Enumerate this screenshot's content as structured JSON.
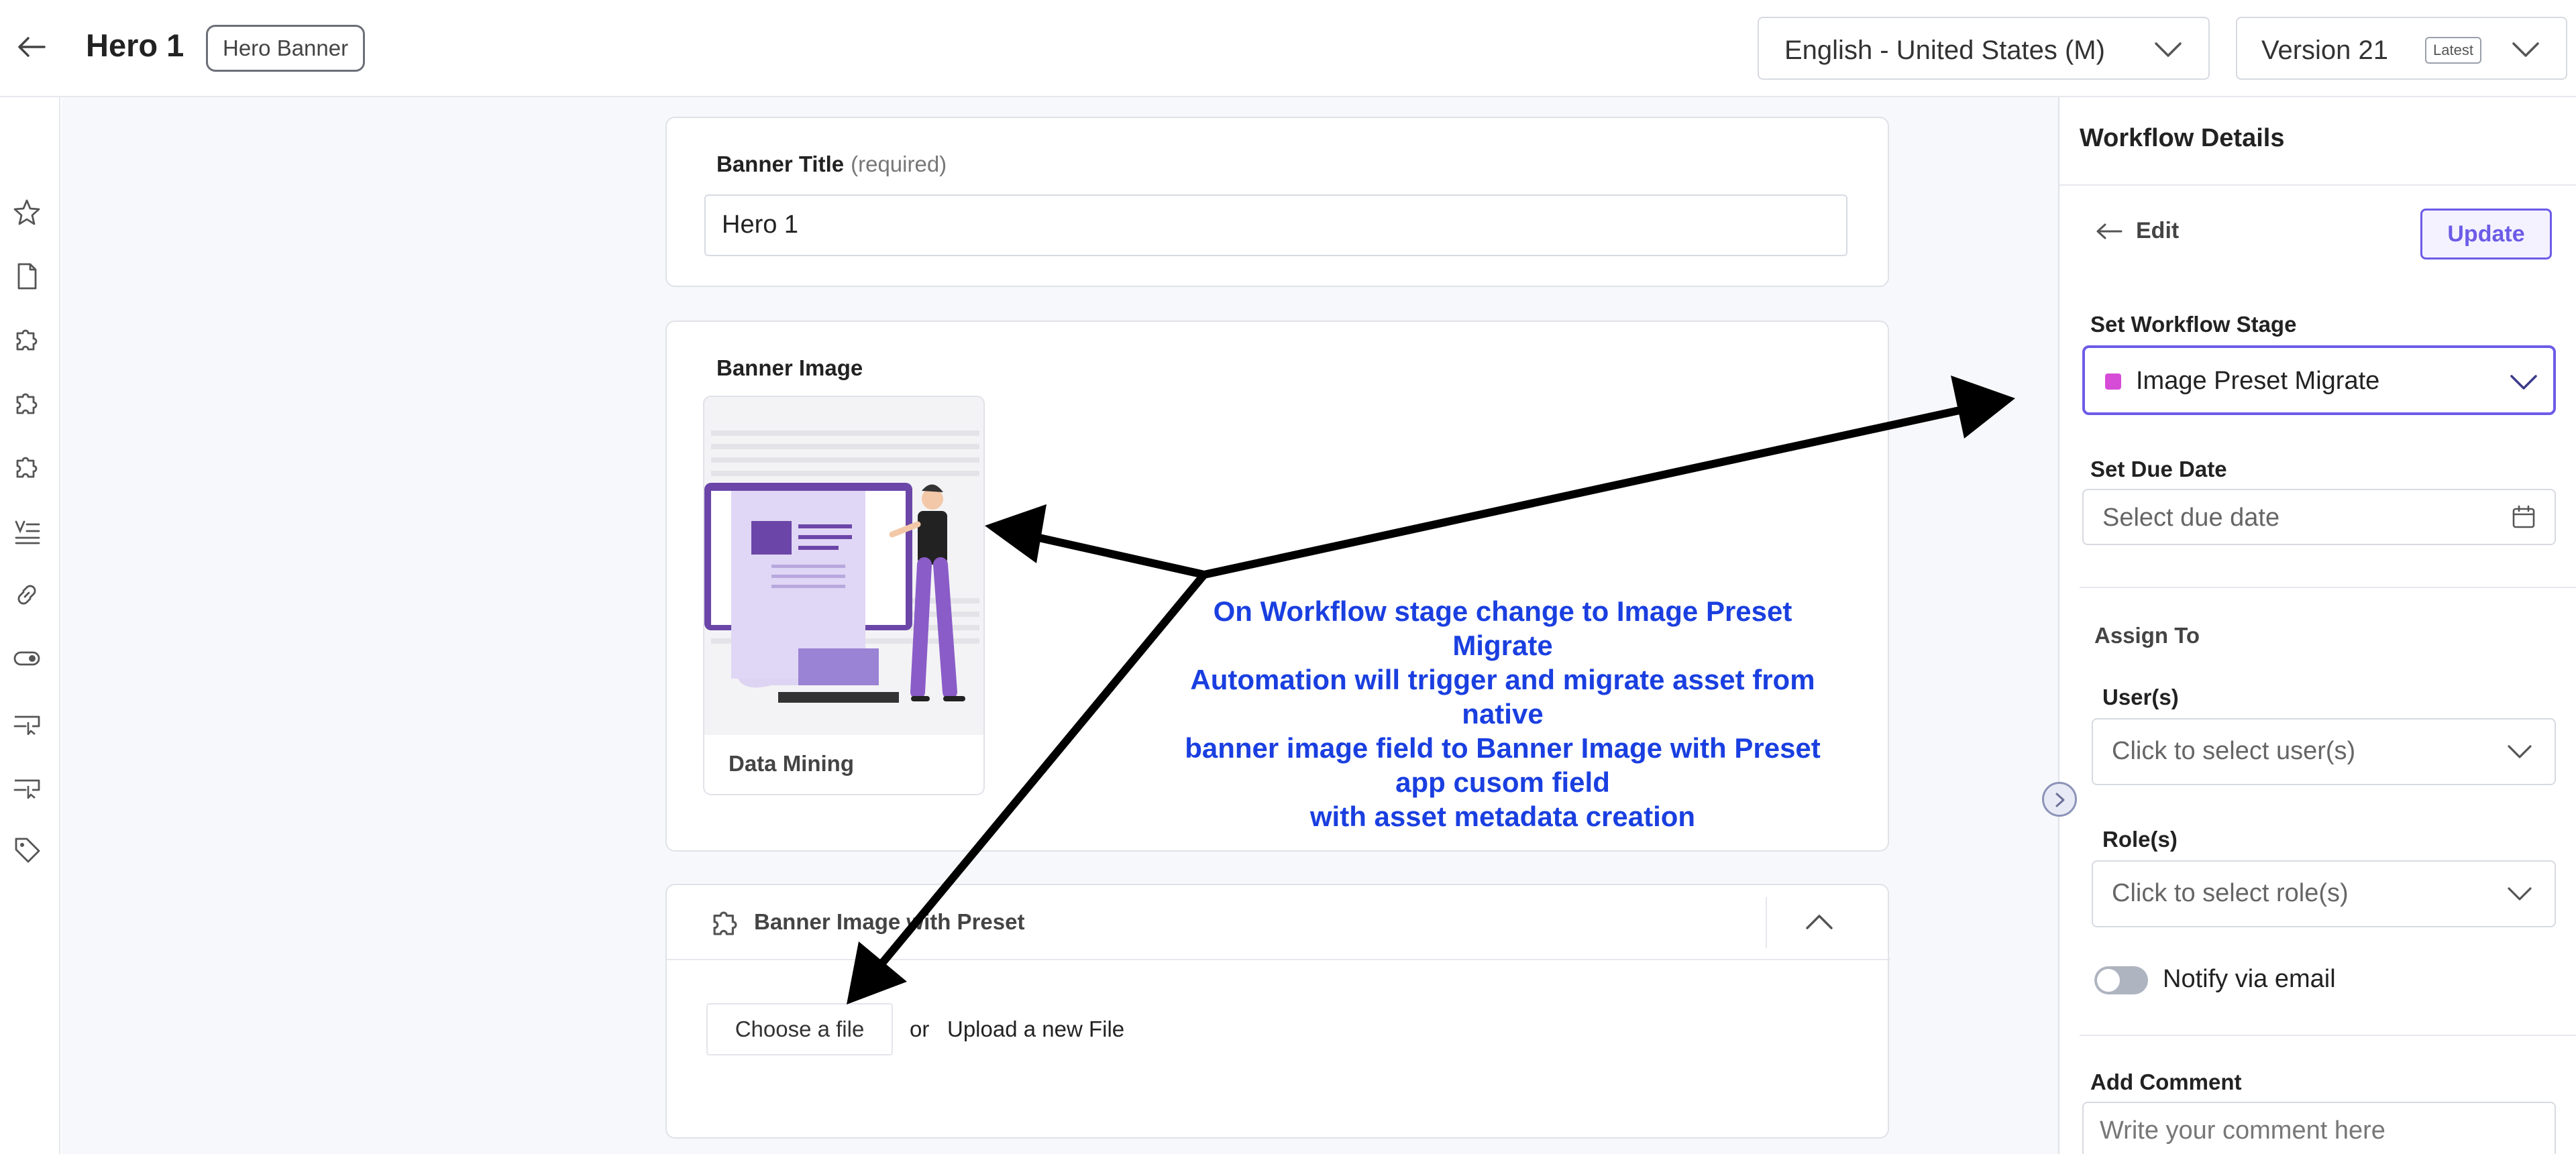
{
  "header": {
    "entry_title": "Hero 1",
    "content_type_badge": "Hero Banner",
    "locale": "English - United States (M)",
    "version": "Version 21",
    "version_badge": "Latest"
  },
  "sidebar": {
    "icons": [
      "star-icon",
      "document-icon",
      "puzzle-icon",
      "puzzle-icon",
      "puzzle-icon",
      "list-icon",
      "link-icon",
      "toggle-icon",
      "cursor-box-icon",
      "cursor-box-icon",
      "tag-icon"
    ]
  },
  "main": {
    "banner_title": {
      "label": "Banner Title",
      "required_note": "(required)",
      "value": "Hero 1"
    },
    "banner_image": {
      "label": "Banner Image",
      "asset_name": "Data Mining"
    },
    "preset": {
      "title": "Banner Image with Preset",
      "choose_label": "Choose a file",
      "or_text": "or",
      "upload_text": "Upload a new File"
    }
  },
  "panel": {
    "title": "Workflow Details",
    "edit_label": "Edit",
    "update_label": "Update",
    "stage_label": "Set Workflow Stage",
    "stage_value": "Image Preset Migrate",
    "stage_color": "#d64cd6",
    "due_label": "Set Due Date",
    "due_placeholder": "Select due date",
    "assign_label": "Assign To",
    "users_label": "User(s)",
    "users_placeholder": "Click to select user(s)",
    "roles_label": "Role(s)",
    "roles_placeholder": "Click to select role(s)",
    "notify_label": "Notify via email",
    "notify_enabled": false,
    "comment_label": "Add Comment",
    "comment_placeholder": "Write your comment here"
  },
  "annotation": {
    "lines": [
      "On Workflow stage change to Image Preset",
      "Migrate",
      "Automation will trigger and migrate asset from",
      "native",
      "banner image field to Banner Image with Preset",
      "app cusom field",
      "with asset metadata creation"
    ],
    "color": "#1a3fe0"
  },
  "colors": {
    "accent": "#6c5ce7",
    "canvas_bg": "#f7f8fb"
  }
}
